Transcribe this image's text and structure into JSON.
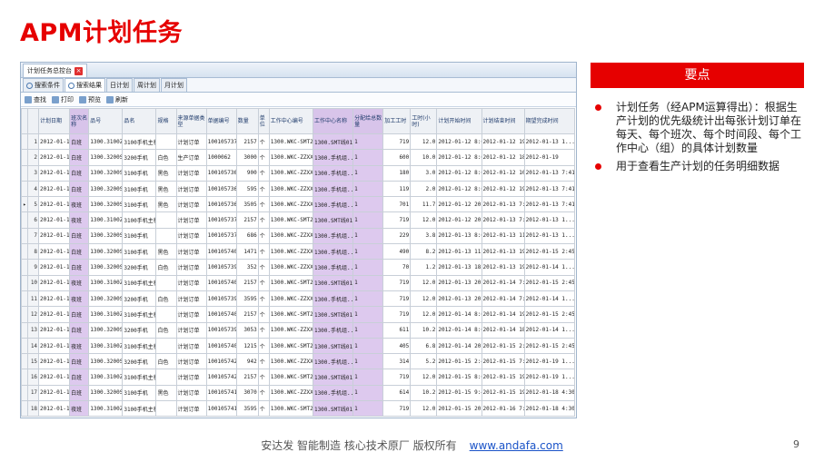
{
  "slide": {
    "title": "APM计划任务",
    "page_number": "9"
  },
  "window": {
    "tab_title": "计划任务总控台",
    "sub_tabs": [
      "搜索条件",
      "搜索结果",
      "日计划",
      "周计划",
      "月计划"
    ],
    "toolbar": [
      "查找",
      "打印",
      "预览",
      "刷新"
    ],
    "columns": [
      "",
      "计划日期",
      "班次名称",
      "品号",
      "品名",
      "规格",
      "来源单据类型",
      "单据编号",
      "数量",
      "单位",
      "工作中心编号",
      "工作中心名称",
      "分配给总数量",
      "加工工时",
      "工时(小时)",
      "计划开始时间",
      "计划结束时间",
      "期望完成时间"
    ],
    "rows": [
      [
        "1",
        "2012-01-12",
        "白班",
        "1300.3100ZB",
        "3100手机主板",
        "",
        "计划订单",
        "100105737",
        "2157",
        "个",
        "1300.WKC-SMT201",
        "1300.SMT线01",
        "1",
        "719",
        "12.0",
        "2012-01-12 8:00",
        "2012-01-12 19:59",
        "2012-01-13 1..."
      ],
      [
        "2",
        "2012-01-12",
        "白班",
        "1300.3200SJF",
        "3200手机",
        "白色",
        "生产订单",
        "1000062",
        "3000",
        "个",
        "1300.WKC-ZZXX",
        "1300.手机组...",
        "1",
        "600",
        "10.0",
        "2012-01-12 8:00",
        "2012-01-12 18:00",
        "2012-01-19"
      ],
      [
        "3",
        "2012-01-12",
        "白班",
        "1300.3200SJA",
        "3100手机",
        "黑色",
        "计划订单",
        "100105736",
        "900",
        "个",
        "1300.WKC-ZZXX",
        "1300.手机组...",
        "1",
        "180",
        "3.0",
        "2012-01-12 8:00",
        "2012-01-12 10:59",
        "2012-01-13 7:41"
      ],
      [
        "4",
        "2012-01-12",
        "白班",
        "1300.3200SJB",
        "3100手机",
        "黑色",
        "计划订单",
        "100105736",
        "595",
        "个",
        "1300.WKC-ZZXX",
        "1300.手机组...",
        "1",
        "119",
        "2.0",
        "2012-01-12 8:00",
        "2012-01-12 19:59",
        "2012-01-13 7:41"
      ],
      [
        "5",
        "2012-01-12",
        "夜班",
        "1300.3200SJA",
        "3100手机",
        "黑色",
        "计划订单",
        "100105736",
        "3505",
        "个",
        "1300.WKC-ZZXX",
        "1300.手机组...",
        "1",
        "701",
        "11.7",
        "2012-01-12 20:00",
        "2012-01-13 7:41",
        "2012-01-13 7:41"
      ],
      [
        "6",
        "2012-01-12",
        "夜班",
        "1300.3100ZB",
        "3100手机主板",
        "",
        "计划订单",
        "100105737",
        "2157",
        "个",
        "1300.WKC-SMT201",
        "1300.SMT线01",
        "1",
        "719",
        "12.0",
        "2012-01-12 20:00",
        "2012-01-13 7:59",
        "2012-01-13 1..."
      ],
      [
        "7",
        "2012-01-13",
        "白班",
        "1300.3200SJB",
        "3100手机",
        "",
        "计划订单",
        "100105737",
        "686",
        "个",
        "1300.WKC-ZZXX",
        "1300.手机组...",
        "1",
        "229",
        "3.8",
        "2012-01-13 8:00",
        "2012-01-13 11:48",
        "2012-01-13 1..."
      ],
      [
        "8",
        "2012-01-13",
        "白班",
        "1300.3200SJB",
        "3100手机",
        "黑色",
        "计划订单",
        "100105740",
        "1471",
        "个",
        "1300.WKC-ZZXX",
        "1300.手机组...",
        "1",
        "490",
        "8.2",
        "2012-01-13 11:48",
        "2012-01-13 19:59",
        "2012-01-15 2:45"
      ],
      [
        "9",
        "2012-01-13",
        "白班",
        "1300.3200SJF",
        "3200手机",
        "白色",
        "计划订单",
        "100105739",
        "352",
        "个",
        "1300.WKC-ZZXX",
        "1300.手机组...",
        "1",
        "70",
        "1.2",
        "2012-01-13 18:48",
        "2012-01-13 19:59",
        "2012-01-14 1..."
      ],
      [
        "10",
        "2012-01-13",
        "夜班",
        "1300.3100ZB",
        "3100手机主板",
        "",
        "计划订单",
        "100105740",
        "2157",
        "个",
        "1300.WKC-SMT201",
        "1300.SMT线01",
        "1",
        "719",
        "12.0",
        "2012-01-13 20:00",
        "2012-01-14 7:59",
        "2012-01-15 2:45"
      ],
      [
        "11",
        "2012-01-13",
        "夜班",
        "1300.3200SJF",
        "3200手机",
        "白色",
        "计划订单",
        "100105739",
        "3595",
        "个",
        "1300.WKC-ZZXX",
        "1300.手机组...",
        "1",
        "719",
        "12.0",
        "2012-01-13 20:00",
        "2012-01-14 7:59",
        "2012-01-14 1..."
      ],
      [
        "12",
        "2012-01-14",
        "白班",
        "1300.3100ZB",
        "3100手机主板",
        "",
        "计划订单",
        "100105740",
        "2157",
        "个",
        "1300.WKC-SMT201",
        "1300.SMT线01",
        "1",
        "719",
        "12.0",
        "2012-01-14 8:00",
        "2012-01-14 19:59",
        "2012-01-15 2:45"
      ],
      [
        "13",
        "2012-01-14",
        "白班",
        "1300.3200SJF",
        "3200手机",
        "白色",
        "计划订单",
        "100105739",
        "3053",
        "个",
        "1300.WKC-ZZXX",
        "1300.手机组...",
        "1",
        "611",
        "10.2",
        "2012-01-14 8:00",
        "2012-01-14 18:10",
        "2012-01-14 1..."
      ],
      [
        "14",
        "2012-01-14",
        "夜班",
        "1300.3100ZB",
        "3100手机主板",
        "",
        "计划订单",
        "100105740",
        "1215",
        "个",
        "1300.WKC-SMT201",
        "1300.SMT线01",
        "1",
        "405",
        "6.8",
        "2012-01-14 20:00",
        "2012-01-15 2:45",
        "2012-01-15 2:45"
      ],
      [
        "15",
        "2012-01-14",
        "白班",
        "1300.3200SJF",
        "3200手机",
        "白色",
        "计划订单",
        "100105742",
        "942",
        "个",
        "1300.WKC-ZZXX",
        "1300.手机组...",
        "1",
        "314",
        "5.2",
        "2012-01-15 2:45",
        "2012-01-15 7:59",
        "2012-01-19 1..."
      ],
      [
        "16",
        "2012-01-15",
        "白班",
        "1300.3100ZB",
        "3100手机主板",
        "",
        "计划订单",
        "100105742",
        "2157",
        "个",
        "1300.WKC-SMT201",
        "1300.SMT线01",
        "1",
        "719",
        "12.0",
        "2012-01-15 8:00",
        "2012-01-15 19:59",
        "2012-01-19 1..."
      ],
      [
        "17",
        "2012-01-15",
        "白班",
        "1300.3200SJA",
        "3100手机",
        "黑色",
        "计划订单",
        "100105741",
        "3070",
        "个",
        "1300.WKC-ZZXX",
        "1300.手机组...",
        "1",
        "614",
        "10.2",
        "2012-01-15 9:45",
        "2012-01-15 19:59",
        "2012-01-18 4:30"
      ],
      [
        "18",
        "2012-01-15",
        "夜班",
        "1300.3100ZB",
        "3100手机主板",
        "",
        "计划订单",
        "100105741",
        "3595",
        "个",
        "1300.WKC-SMT201",
        "1300.SMT线01",
        "1",
        "719",
        "12.0",
        "2012-01-15 20:00",
        "2012-01-16 7:59",
        "2012-01-18 4:30"
      ]
    ]
  },
  "panel": {
    "header": "要点",
    "bullets": [
      "计划任务（经APM运算得出）：根据生产计划的优先级统计出每张计划订单在每天、每个班次、每个时间段、每个工作中心（组）的具体计划数量",
      "用于查看生产计划的任务明细数据"
    ]
  },
  "footer": {
    "text": "安达发   智能制造 核心技术原厂   版权所有",
    "link": "www.andafa.com"
  },
  "colors": {
    "accent": "#e60000",
    "highlight_column": "#ddc9ee"
  }
}
